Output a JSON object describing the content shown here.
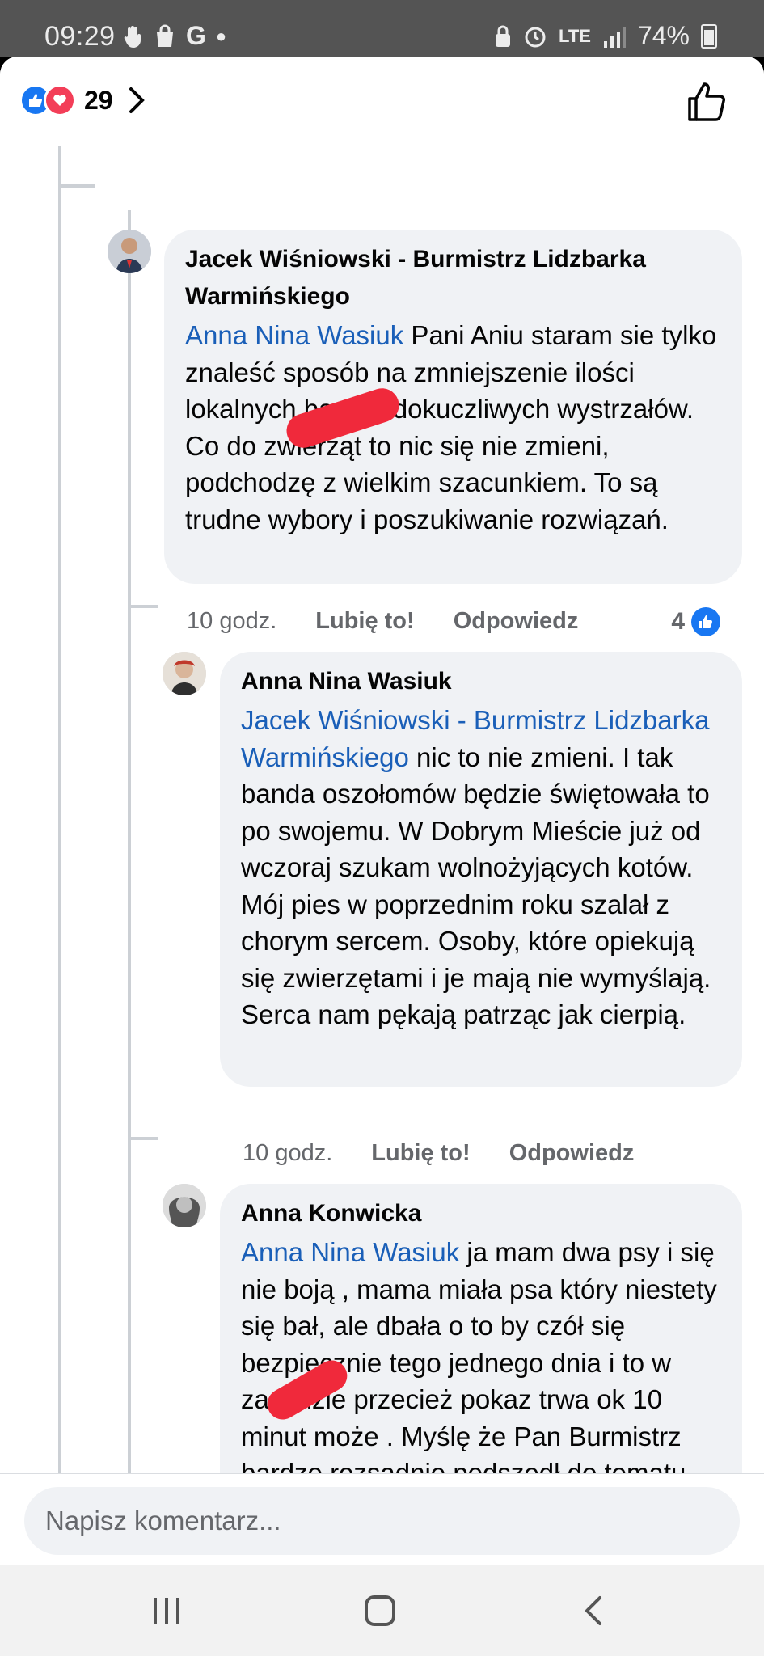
{
  "status_bar": {
    "time": "09:29",
    "left_icons": [
      "hand-icon",
      "bag-icon",
      "google-icon",
      "dot-icon"
    ],
    "lte_label": "LTE",
    "battery": "74%"
  },
  "header": {
    "reaction_count": "29",
    "reaction_icons": [
      "like-icon",
      "love-icon"
    ]
  },
  "comments": [
    {
      "author": "Jacek Wiśniowski - Burmistrz Lidzbarka Warmińskiego",
      "mention": "Anna Nina Wasiuk",
      "text": " Pani Aniu staram sie tylko znaleść sposób na zmniejszenie ilości lokalnych bardzo dokuczliwych wystrzałów. Co do zwierząt to nic się nie zmieni, podchodzę z wielkim szacunkiem. To są trudne wybory i poszukiwanie rozwiązań.",
      "time": "10 godz.",
      "like_label": "Lubię to!",
      "reply_label": "Odpowiedz",
      "likes": "4"
    },
    {
      "author": "Anna Nina Wasiuk",
      "mention": "Jacek Wiśniowski - Burmistrz Lidzbarka Warmińskiego",
      "text": " nic to nie zmieni. I tak banda oszołomów będzie świętowała to po swojemu. W Dobrym Mieście już od wczoraj szukam wolnożyjących kotów. Mój pies w poprzednim roku szalał z chorym sercem. Osoby, które opiekują się zwierzętami i je mają nie wymyślają. Serca nam pękają patrząc jak cierpią.",
      "time": "10 godz.",
      "like_label": "Lubię to!",
      "reply_label": "Odpowiedz"
    },
    {
      "author": "Anna Konwicka",
      "mention": "Anna Nina Wasiuk",
      "text": " ja mam dwa psy i się nie boją , mama miała psa który niestety się bał, ale dbała o to by czół się bezpiecznie tego jednego dnia i to w zasadzie przecież pokaz trwa ok 10 minut może . Myślę że Pan Burmistrz bardzo rozsądnie podszedł do tematu . A na to, że"
    }
  ],
  "composer": {
    "placeholder": "Napisz komentarz..."
  },
  "colors": {
    "mention": "#1a5fb8",
    "bubble_bg": "#f0f2f5",
    "like_blue": "#1877f2",
    "love_red": "#f33e58",
    "redaction": "#f0293b"
  }
}
